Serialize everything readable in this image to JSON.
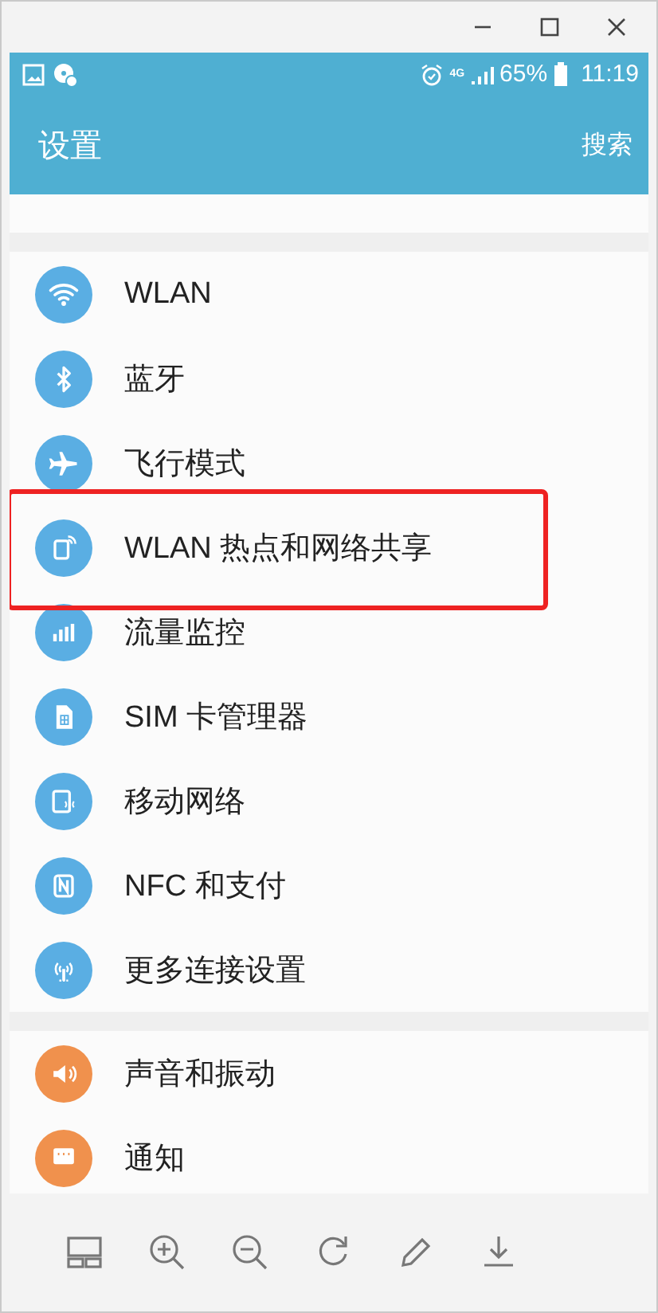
{
  "status_bar": {
    "network": "4G",
    "battery": "65%",
    "time": "11:19"
  },
  "app_bar": {
    "title": "设置",
    "action": "搜索"
  },
  "sections": [
    {
      "items": [
        {
          "kind": "wifi",
          "label": "WLAN",
          "color": "#5aaee3",
          "highlighted": false
        },
        {
          "kind": "bluetooth",
          "label": "蓝牙",
          "color": "#5aaee3",
          "highlighted": false
        },
        {
          "kind": "airplane",
          "label": "飞行模式",
          "color": "#5aaee3",
          "highlighted": false
        },
        {
          "kind": "hotspot",
          "label": "WLAN 热点和网络共享",
          "color": "#5aaee3",
          "highlighted": true
        },
        {
          "kind": "data",
          "label": "流量监控",
          "color": "#5aaee3",
          "highlighted": false
        },
        {
          "kind": "sim",
          "label": "SIM 卡管理器",
          "color": "#5aaee3",
          "highlighted": false
        },
        {
          "kind": "mobile",
          "label": "移动网络",
          "color": "#5aaee3",
          "highlighted": false
        },
        {
          "kind": "nfc",
          "label": "NFC 和支付",
          "color": "#5aaee3",
          "highlighted": false
        },
        {
          "kind": "more",
          "label": "更多连接设置",
          "color": "#5aaee3",
          "highlighted": false
        }
      ]
    },
    {
      "items": [
        {
          "kind": "sound",
          "label": "声音和振动",
          "color": "#f0914d",
          "highlighted": false
        },
        {
          "kind": "notification",
          "label": "通知",
          "color": "#f0914d",
          "highlighted": false
        }
      ]
    }
  ]
}
